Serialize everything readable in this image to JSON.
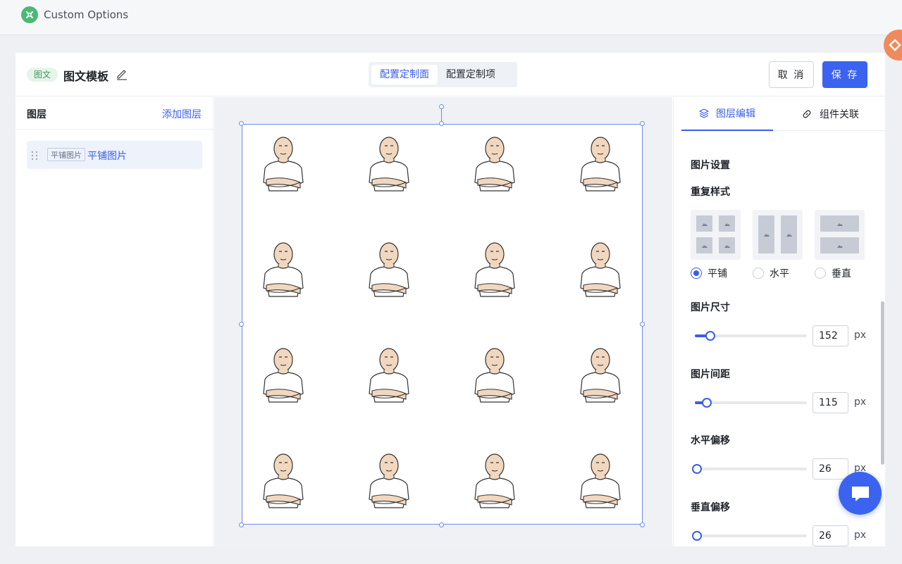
{
  "app": {
    "title": "Custom Options"
  },
  "header": {
    "tag": "图文",
    "template_title": "图文模板",
    "segments": [
      {
        "label": "配置定制面",
        "active": true
      },
      {
        "label": "配置定制项",
        "active": false
      }
    ],
    "cancel_label": "取 消",
    "save_label": "保 存"
  },
  "layers": {
    "title": "图层",
    "add_label": "添加图层",
    "items": [
      {
        "tag": "平铺图片",
        "name": "平铺图片"
      }
    ]
  },
  "canvas": {
    "rows": 4,
    "cols": 4
  },
  "panel": {
    "tabs": [
      {
        "label": "图层编辑",
        "icon": "layers-icon",
        "active": true
      },
      {
        "label": "组件关联",
        "icon": "link-icon",
        "active": false
      }
    ],
    "image_settings_title": "图片设置",
    "repeat_style_title": "重复样式",
    "repeat_options": [
      {
        "label": "平铺",
        "selected": true
      },
      {
        "label": "水平",
        "selected": false
      },
      {
        "label": "垂直",
        "selected": false
      }
    ],
    "size": {
      "label": "图片尺寸",
      "value": "152",
      "unit": "px",
      "level": 0.14
    },
    "spacing": {
      "label": "图片间距",
      "value": "115",
      "unit": "px",
      "level": 0.11
    },
    "offset_x": {
      "label": "水平偏移",
      "value": "26",
      "unit": "px",
      "level": 0.02
    },
    "offset_y": {
      "label": "垂直偏移",
      "value": "26",
      "unit": "px",
      "level": 0.02
    }
  },
  "colors": {
    "accent": "#3b63f0",
    "brand_green": "#4cb974",
    "tag_bg": "#e6f4ea"
  }
}
